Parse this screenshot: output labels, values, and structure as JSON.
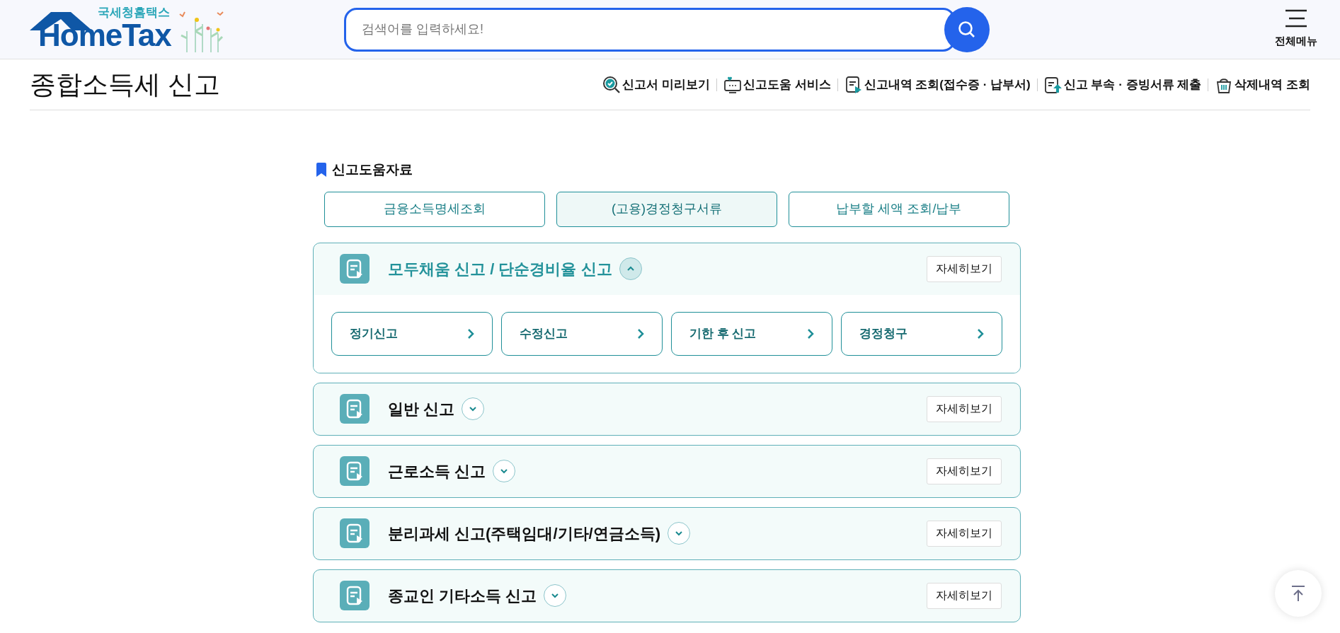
{
  "header": {
    "logo_subtitle": "국세청홈택스",
    "logo_title": "HomeTax",
    "search": {
      "placeholder": "검색어를 입력하세요!"
    },
    "menu_label": "전체메뉴"
  },
  "page_title": "종합소득세 신고",
  "toolbar": [
    {
      "kind": "preview",
      "label": "신고서 미리보기"
    },
    {
      "kind": "help",
      "label": "신고도움 서비스"
    },
    {
      "kind": "history",
      "label": "신고내역 조회(접수증 · 납부서)"
    },
    {
      "kind": "upload",
      "label": "신고 부속 · 증빙서류 제출"
    },
    {
      "kind": "trash",
      "label": "삭제내역 조회"
    }
  ],
  "help_section": {
    "title": "신고도움자료",
    "tabs": [
      {
        "label": "금융소득명세조회",
        "selected": false
      },
      {
        "label": "(고용)경정청구서류",
        "selected": true
      },
      {
        "label": "납부할 세액 조회/납부",
        "selected": false
      }
    ]
  },
  "accordions": [
    {
      "title": "모두채움 신고 / 단순경비율 신고",
      "expanded": true,
      "detail_button": "자세히보기",
      "items": [
        "정기신고",
        "수정신고",
        "기한 후 신고",
        "경정청구"
      ]
    },
    {
      "title": "일반 신고",
      "expanded": false,
      "detail_button": "자세히보기"
    },
    {
      "title": "근로소득 신고",
      "expanded": false,
      "detail_button": "자세히보기"
    },
    {
      "title": "분리과세 신고(주택임대/기타/연금소득)",
      "expanded": false,
      "detail_button": "자세히보기"
    },
    {
      "title": "종교인 기타소득 신고",
      "expanded": false,
      "detail_button": "자세히보기"
    }
  ]
}
